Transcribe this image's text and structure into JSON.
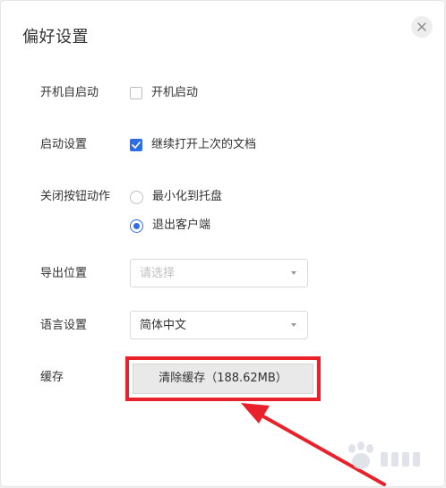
{
  "dialog": {
    "title": "偏好设置"
  },
  "settings": {
    "autostart": {
      "label": "开机自启动",
      "option_label": "开机启动",
      "checked": false
    },
    "startup": {
      "label": "启动设置",
      "option_label": "继续打开上次的文档",
      "checked": true
    },
    "close_action": {
      "label": "关闭按钮动作",
      "options": [
        {
          "label": "最小化到托盘",
          "selected": false
        },
        {
          "label": "退出客户端",
          "selected": true
        }
      ]
    },
    "export_location": {
      "label": "导出位置",
      "placeholder": "请选择"
    },
    "language": {
      "label": "语言设置",
      "value": "简体中文"
    },
    "cache": {
      "label": "缓存",
      "button_label": "清除缓存（188.62MB）"
    }
  },
  "annotation": {
    "color": "#e8212b"
  },
  "colors": {
    "accent": "#2d6ee8"
  },
  "icons": {
    "close": "close-icon",
    "checkmark": "checkmark-icon",
    "dropdown": "chevron-down-icon"
  }
}
